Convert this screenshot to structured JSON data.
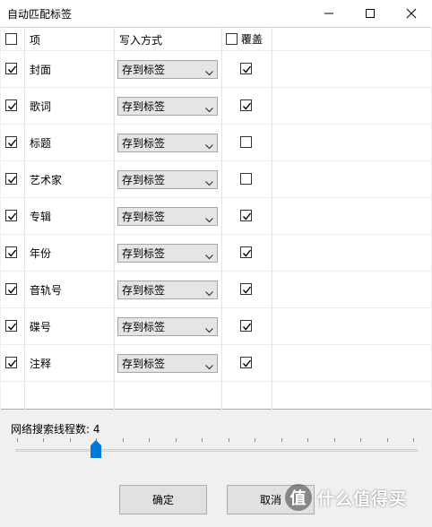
{
  "window": {
    "title": "自动匹配标签"
  },
  "headers": {
    "item": "项",
    "mode": "写入方式",
    "overwrite": "覆盖",
    "select_all_checked": false,
    "overwrite_all_checked": false
  },
  "rows": [
    {
      "name": "封面",
      "checked": true,
      "mode": "存到标签",
      "overwrite": true
    },
    {
      "name": "歌词",
      "checked": true,
      "mode": "存到标签",
      "overwrite": true
    },
    {
      "name": "标题",
      "checked": true,
      "mode": "存到标签",
      "overwrite": false
    },
    {
      "name": "艺术家",
      "checked": true,
      "mode": "存到标签",
      "overwrite": false
    },
    {
      "name": "专辑",
      "checked": true,
      "mode": "存到标签",
      "overwrite": true
    },
    {
      "name": "年份",
      "checked": true,
      "mode": "存到标签",
      "overwrite": true
    },
    {
      "name": "音轨号",
      "checked": true,
      "mode": "存到标签",
      "overwrite": true
    },
    {
      "name": "碟号",
      "checked": true,
      "mode": "存到标签",
      "overwrite": true
    },
    {
      "name": "注释",
      "checked": true,
      "mode": "存到标签",
      "overwrite": true
    }
  ],
  "threads": {
    "label": "网络搜索线程数: 4",
    "value": 4,
    "min": 1,
    "max": 16
  },
  "buttons": {
    "ok": "确定",
    "cancel": "取消"
  },
  "watermark": {
    "logo": "值",
    "text": "什么值得买"
  },
  "colors": {
    "accent": "#0078d7",
    "check": "#000000"
  }
}
